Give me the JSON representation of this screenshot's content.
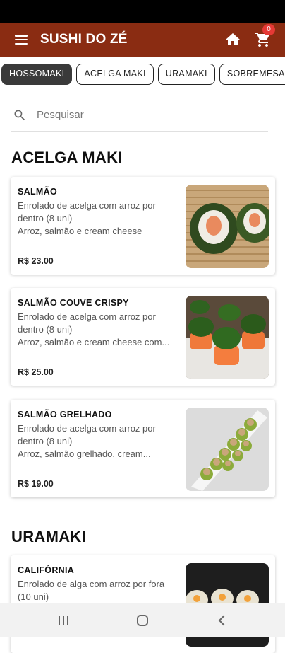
{
  "app": {
    "title": "SUSHI DO ZÉ",
    "cart_count": "0"
  },
  "colors": {
    "appbar": "#8a2c12",
    "badge": "#e53935",
    "active_tab": "#3a3a3a"
  },
  "tabs": [
    {
      "label": "HOSSOMAKI",
      "active": true
    },
    {
      "label": "ACELGA MAKI",
      "active": false
    },
    {
      "label": "URAMAKI",
      "active": false
    },
    {
      "label": "SOBREMESAS",
      "active": false
    }
  ],
  "search": {
    "placeholder": "Pesquisar"
  },
  "sections": [
    {
      "title": "ACELGA MAKI",
      "items": [
        {
          "name": "SALMÃO",
          "desc1": "Enrolado de acelga com arroz por",
          "desc2": "dentro (8 uni)",
          "desc3": "Arroz, salmão e cream cheese",
          "price": "R$ 23.00"
        },
        {
          "name": "SALMÃO COUVE CRISPY",
          "desc1": "Enrolado de acelga com arroz por",
          "desc2": "dentro (8 uni)",
          "desc3": "Arroz, salmão e cream cheese com...",
          "price": "R$ 25.00"
        },
        {
          "name": "SALMÃO GRELHADO",
          "desc1": "Enrolado de acelga com arroz por",
          "desc2": "dentro (8 uni)",
          "desc3": "Arroz, salmão grelhado, cream...",
          "price": "R$ 19.00"
        }
      ]
    },
    {
      "title": "URAMAKI",
      "items": [
        {
          "name": "CALIFÓRNIA",
          "desc1": "Enrolado de alga com arroz por fora",
          "desc2": "(10 uni)"
        }
      ]
    }
  ],
  "icons": {
    "menu": "hamburger-icon",
    "home": "home-icon",
    "cart": "cart-icon",
    "search": "search-icon"
  }
}
